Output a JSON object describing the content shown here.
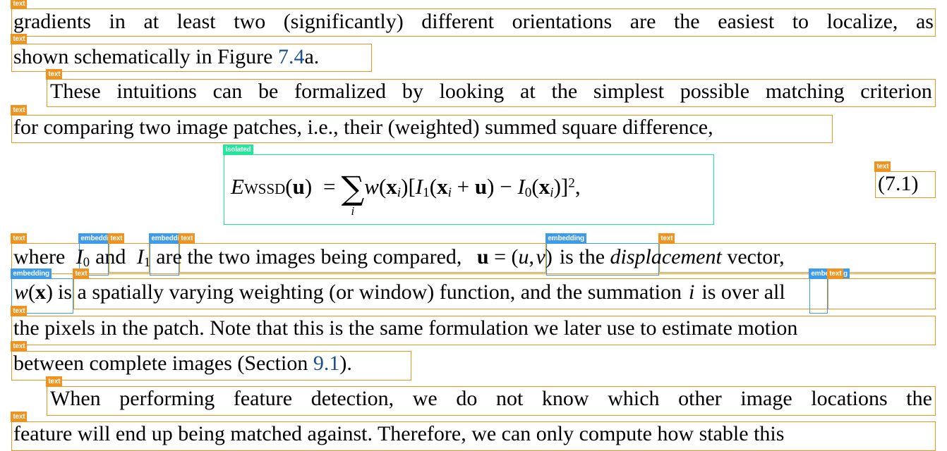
{
  "document": {
    "type": "layout-analysis-overlay",
    "page_background": "#ffffff",
    "colors": {
      "text_region": "#f0921e",
      "embedding_region": "#3d9bea",
      "isolated_region": "#21e79a",
      "body_text": "#000000",
      "cross_reference_link": "#1c4f87"
    },
    "region_labels": {
      "text": "text",
      "embedding": "embedding",
      "isolated": "isolated"
    },
    "lines": [
      {
        "id": "line-1",
        "label": "text",
        "text": "gradients in at least two (significantly) different orientations are the easiest to localize, as"
      },
      {
        "id": "line-2",
        "label": "text",
        "text_before": "shown schematically in Figure ",
        "link": "7.4",
        "text_after": "a."
      },
      {
        "id": "line-3",
        "label": "text",
        "text": "These intuitions can be formalized by looking at the simplest possible matching criterion"
      },
      {
        "id": "line-4",
        "label": "text",
        "text": "for comparing two image patches, i.e., their (weighted) summed square difference,"
      },
      {
        "id": "line-5a",
        "label": "text",
        "text": "where"
      },
      {
        "id": "line-5b",
        "label": "embedding",
        "math": "I0"
      },
      {
        "id": "line-5c",
        "label": "text",
        "text": "and"
      },
      {
        "id": "line-5d",
        "label": "embedding",
        "math": "I1"
      },
      {
        "id": "line-5e",
        "label": "text",
        "text": "are the two images being compared,"
      },
      {
        "id": "line-5f",
        "label": "embedding",
        "math": "u = (u, v)"
      },
      {
        "id": "line-5g",
        "label": "text",
        "text_plain": "is the ",
        "italic": "displacement",
        "text_tail": " vector,"
      },
      {
        "id": "line-6a",
        "label": "embedding",
        "math": "w(x)"
      },
      {
        "id": "line-6b",
        "label": "text",
        "text": "is a spatially varying weighting (or window) function, and the summation"
      },
      {
        "id": "line-6c",
        "label": "embedding",
        "math": "i"
      },
      {
        "id": "line-6d",
        "label": "text",
        "text": "is over all"
      },
      {
        "id": "line-7",
        "label": "text",
        "text": "the pixels in the patch. Note that this is the same formulation we later use to estimate motion"
      },
      {
        "id": "line-8",
        "label": "text",
        "text_before": "between complete images (Section ",
        "link": "9.1",
        "text_after": ")."
      },
      {
        "id": "line-9",
        "label": "text",
        "text": "When performing feature detection, we do not know which other image locations the"
      },
      {
        "id": "line-10",
        "label": "text",
        "text": "feature will end up being matched against. Therefore, we can only compute how stable this"
      }
    ],
    "equation": {
      "label": "isolated",
      "lhs_E": "E",
      "lhs_sub": "WSSD",
      "lhs_arg": "(u)",
      "equals": "=",
      "sum_symbol": "∑",
      "sum_index": "i",
      "body": "w(xᵢ)[I₁(xᵢ + u) − I₀(xᵢ)]²,",
      "plain": "E_WSSD(u) = ∑_i w(x_i)[I_1(x_i + u) - I_0(x_i)]^2,"
    },
    "equation_number": {
      "label": "text",
      "value": "(7.1)"
    }
  }
}
